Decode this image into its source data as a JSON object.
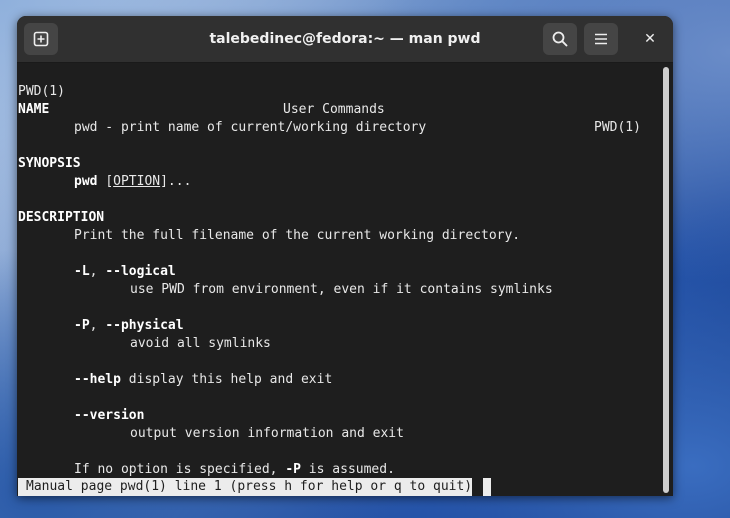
{
  "window": {
    "title": "talebedinec@fedora:~ — man pwd",
    "buttons": {
      "new_tab_icon": "new-tab-icon",
      "search_icon": "search-icon",
      "menu_icon": "hamburger-menu-icon",
      "close_glyph": "✕"
    }
  },
  "man": {
    "header_left": "PWD(1)",
    "header_center": "User Commands",
    "header_right": "PWD(1)",
    "name_heading": "NAME",
    "name_text": "pwd - print name of current/working directory",
    "synopsis_heading": "SYNOPSIS",
    "synopsis_cmd": "pwd",
    "synopsis_space": " ",
    "synopsis_open": "[",
    "synopsis_option": "OPTION",
    "synopsis_close": "]...",
    "description_heading": "DESCRIPTION",
    "description_text": "Print the full filename of the current working directory.",
    "opt_L_short": "-L",
    "opt_L_sep": ", ",
    "opt_L_long": "--logical",
    "opt_L_desc": "use PWD from environment, even if it contains symlinks",
    "opt_P_short": "-P",
    "opt_P_sep": ", ",
    "opt_P_long": "--physical",
    "opt_P_desc": "avoid all symlinks",
    "opt_help": "--help",
    "opt_help_desc": " display this help and exit",
    "opt_version": "--version",
    "opt_version_desc": "output version information and exit",
    "note_prefix": "If no option is specified, ",
    "note_flag": "-P",
    "note_suffix": " is assumed."
  },
  "status_line": "Manual page pwd(1) line 1 (press h for help or q to quit)"
}
